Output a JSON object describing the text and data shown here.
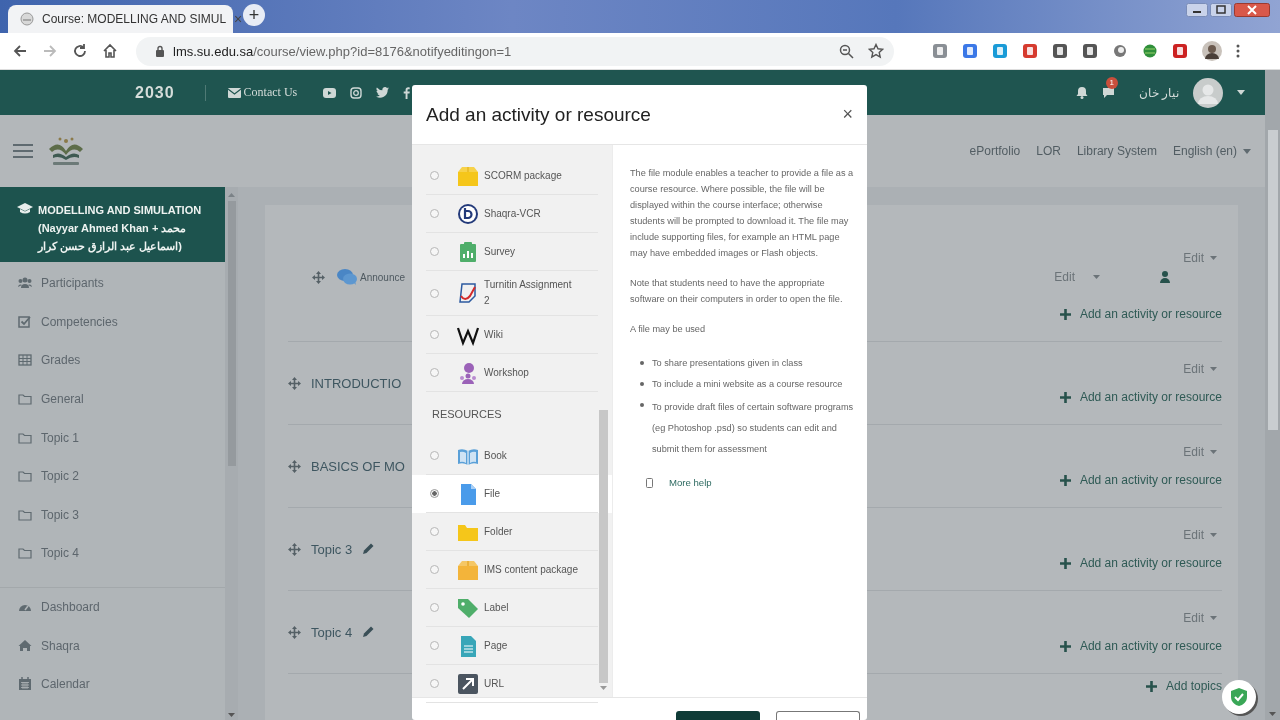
{
  "browser": {
    "tab": {
      "title": "Course: MODELLING AND SIMUL",
      "close": "×"
    },
    "new_tab": "+",
    "url": {
      "host": "lms.su.edu.sa",
      "path": "/course/view.php?id=8176&notifyeditingon=1"
    }
  },
  "header": {
    "vision_logo": "2030",
    "contact": "Contact Us",
    "notification_count": "1",
    "user_name": "نيار خان"
  },
  "nav": {
    "links": [
      "ePortfolio",
      "LOR",
      "Library System"
    ],
    "language": "English (en)"
  },
  "sidebar": {
    "course": "MODELLING AND SIMULATION (Nayyar Ahmed Khan + محمد اسماعيل عبد الرازق حسن كرار)",
    "items": [
      {
        "label": "Participants",
        "kind": "users"
      },
      {
        "label": "Competencies",
        "kind": "check"
      },
      {
        "label": "Grades",
        "kind": "table"
      },
      {
        "label": "General",
        "kind": "folder"
      },
      {
        "label": "Topic 1",
        "kind": "folder"
      },
      {
        "label": "Topic 2",
        "kind": "folder"
      },
      {
        "label": "Topic 3",
        "kind": "folder"
      },
      {
        "label": "Topic 4",
        "kind": "folder"
      }
    ],
    "items2": [
      {
        "label": "Dashboard",
        "kind": "gauge"
      },
      {
        "label": "Shaqra",
        "kind": "home"
      },
      {
        "label": "Calendar",
        "kind": "calendar"
      }
    ]
  },
  "sections": [
    {
      "pencil": false,
      "edit": "Edit",
      "activities": [
        {
          "name": "Announce",
          "edit": "Edit"
        }
      ],
      "add": "Add an activity or resource"
    },
    {
      "title": "INTRODUCTIO",
      "pencil": false,
      "edit": "Edit",
      "add": "Add an activity or resource"
    },
    {
      "title": "BASICS OF MO",
      "pencil": false,
      "edit": "Edit",
      "add": "Add an activity or resource"
    },
    {
      "title": "Topic 3",
      "pencil": true,
      "edit": "Edit",
      "add": "Add an activity or resource"
    },
    {
      "title": "Topic 4",
      "pencil": true,
      "edit": "Edit",
      "add": "Add an activity or resource"
    }
  ],
  "add_topics": "Add topics",
  "modal": {
    "title": "Add an activity or resource",
    "close": "×",
    "groups": [
      {
        "items": [
          {
            "label": "SCORM package",
            "kind": "scorm",
            "selected": false
          },
          {
            "label": "Shaqra-VCR",
            "kind": "vcr",
            "selected": false
          },
          {
            "label": "Survey",
            "kind": "survey",
            "selected": false
          },
          {
            "label": "Turnitin Assignment 2",
            "kind": "turnitin",
            "selected": false
          },
          {
            "label": "Wiki",
            "kind": "wiki",
            "selected": false
          },
          {
            "label": "Workshop",
            "kind": "workshop",
            "selected": false
          }
        ]
      },
      {
        "heading": "RESOURCES",
        "items": [
          {
            "label": "Book",
            "kind": "book",
            "selected": false
          },
          {
            "label": "File",
            "kind": "file",
            "selected": true
          },
          {
            "label": "Folder",
            "kind": "folder",
            "selected": false
          },
          {
            "label": "IMS content package",
            "kind": "ims",
            "selected": false
          },
          {
            "label": "Label",
            "kind": "label",
            "selected": false
          },
          {
            "label": "Page",
            "kind": "page",
            "selected": false
          },
          {
            "label": "URL",
            "kind": "url",
            "selected": false
          }
        ]
      }
    ],
    "description": {
      "paragraphs": [
        "The file module enables a teacher to provide a file as a course resource. Where possible, the file will be displayed within the course interface; otherwise students will be prompted to download it. The file may include supporting files, for example an HTML page may have embedded images or Flash objects.",
        "Note that students need to have the appropriate software on their computers in order to open the file.",
        "A file may be used"
      ],
      "bullets": [
        "To share presentations given in class",
        "To include a mini website as a course resource",
        "To provide draft files of certain software programs (eg Photoshop .psd) so students can edit and submit them for assessment"
      ],
      "help": "More help"
    }
  }
}
